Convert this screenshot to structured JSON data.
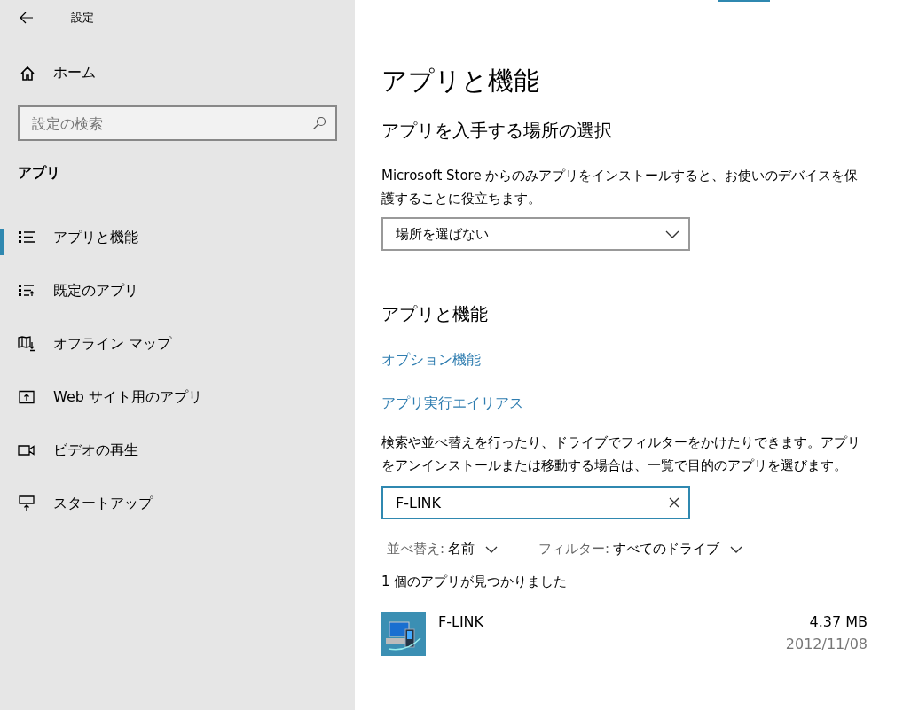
{
  "window": {
    "title": "設定"
  },
  "sidebar": {
    "home": "ホーム",
    "search": {
      "placeholder": "設定の検索"
    },
    "section": "アプリ",
    "items": [
      {
        "label": "アプリと機能",
        "selected": true
      },
      {
        "label": "既定のアプリ",
        "selected": false
      },
      {
        "label": "オフライン マップ",
        "selected": false
      },
      {
        "label": "Web サイト用のアプリ",
        "selected": false
      },
      {
        "label": "ビデオの再生",
        "selected": false
      },
      {
        "label": "スタートアップ",
        "selected": false
      }
    ]
  },
  "main": {
    "title": "アプリと機能",
    "install_source": {
      "heading": "アプリを入手する場所の選択",
      "description": "Microsoft Store からのみアプリをインストールすると、お使いのデバイスを保護することに役立ちます。",
      "dropdown": "場所を選ばない"
    },
    "apps": {
      "heading": "アプリと機能",
      "links": [
        "オプション機能",
        "アプリ実行エイリアス"
      ],
      "description": "検索や並べ替えを行ったり、ドライブでフィルターをかけたりできます。アプリをアンインストールまたは移動する場合は、一覧で目的のアプリを選びます。",
      "search": {
        "value": "F-LINK"
      },
      "sort": {
        "label": "並べ替え:",
        "value": "名前"
      },
      "filter": {
        "label": "フィルター:",
        "value": "すべてのドライブ"
      },
      "result_count": "1 個のアプリが見つかりました",
      "list": [
        {
          "name": "F-LINK",
          "size": "4.37 MB",
          "date": "2012/11/08"
        }
      ]
    }
  }
}
